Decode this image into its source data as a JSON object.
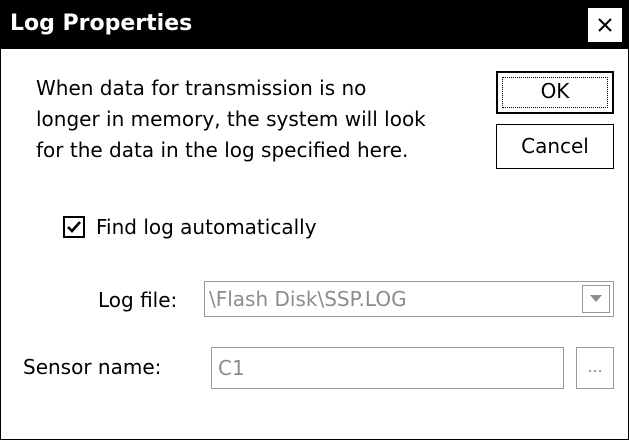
{
  "window": {
    "title": "Log Properties"
  },
  "description": {
    "lines": [
      "When data for transmission is no",
      "longer in memory, the system will look",
      "for the data in the log specified here."
    ]
  },
  "buttons": {
    "ok_label": "OK",
    "cancel_label": "Cancel",
    "browse_label": "..."
  },
  "find_log_automatically": {
    "label": "Find log automatically",
    "checked": true
  },
  "log_file": {
    "label": "Log file:",
    "value": "\\Flash Disk\\SSP.LOG",
    "enabled": false
  },
  "sensor_name": {
    "label": "Sensor name:",
    "value": "C1",
    "enabled": false
  },
  "colors": {
    "titlebar_bg": "#000000",
    "titlebar_fg": "#ffffff",
    "disabled_text": "#8c8c8c",
    "disabled_border": "#999999"
  },
  "icons": {
    "close": "close-icon",
    "checkmark": "checkmark-icon",
    "dropdown": "chevron-down-icon"
  }
}
